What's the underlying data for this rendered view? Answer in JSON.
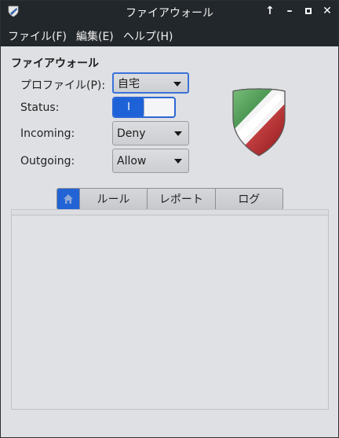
{
  "window": {
    "title": "ファイアウォール",
    "controls": {
      "keep_above": "↑",
      "minimize": "–",
      "maximize": "□",
      "close": "✕"
    }
  },
  "menu": {
    "items": [
      "ファイル(F)",
      "編集(E)",
      "ヘルプ(H)"
    ]
  },
  "firewall": {
    "section_title": "ファイアウォール",
    "profile_label": "プロファイル(P):",
    "profile_value": "自宅",
    "status_label": "Status:",
    "status_on_text": "I",
    "status_enabled": true,
    "incoming_label": "Incoming:",
    "incoming_value": "Deny",
    "outgoing_label": "Outgoing:",
    "outgoing_value": "Allow"
  },
  "tabs": {
    "home_icon": "home-icon",
    "rules": "ルール",
    "report": "レポート",
    "log": "ログ",
    "active": "home"
  },
  "colors": {
    "accent": "#1e62d8",
    "titlebar": "#22272b",
    "shield_green": "#2f8a3a",
    "shield_red": "#c0262b"
  }
}
